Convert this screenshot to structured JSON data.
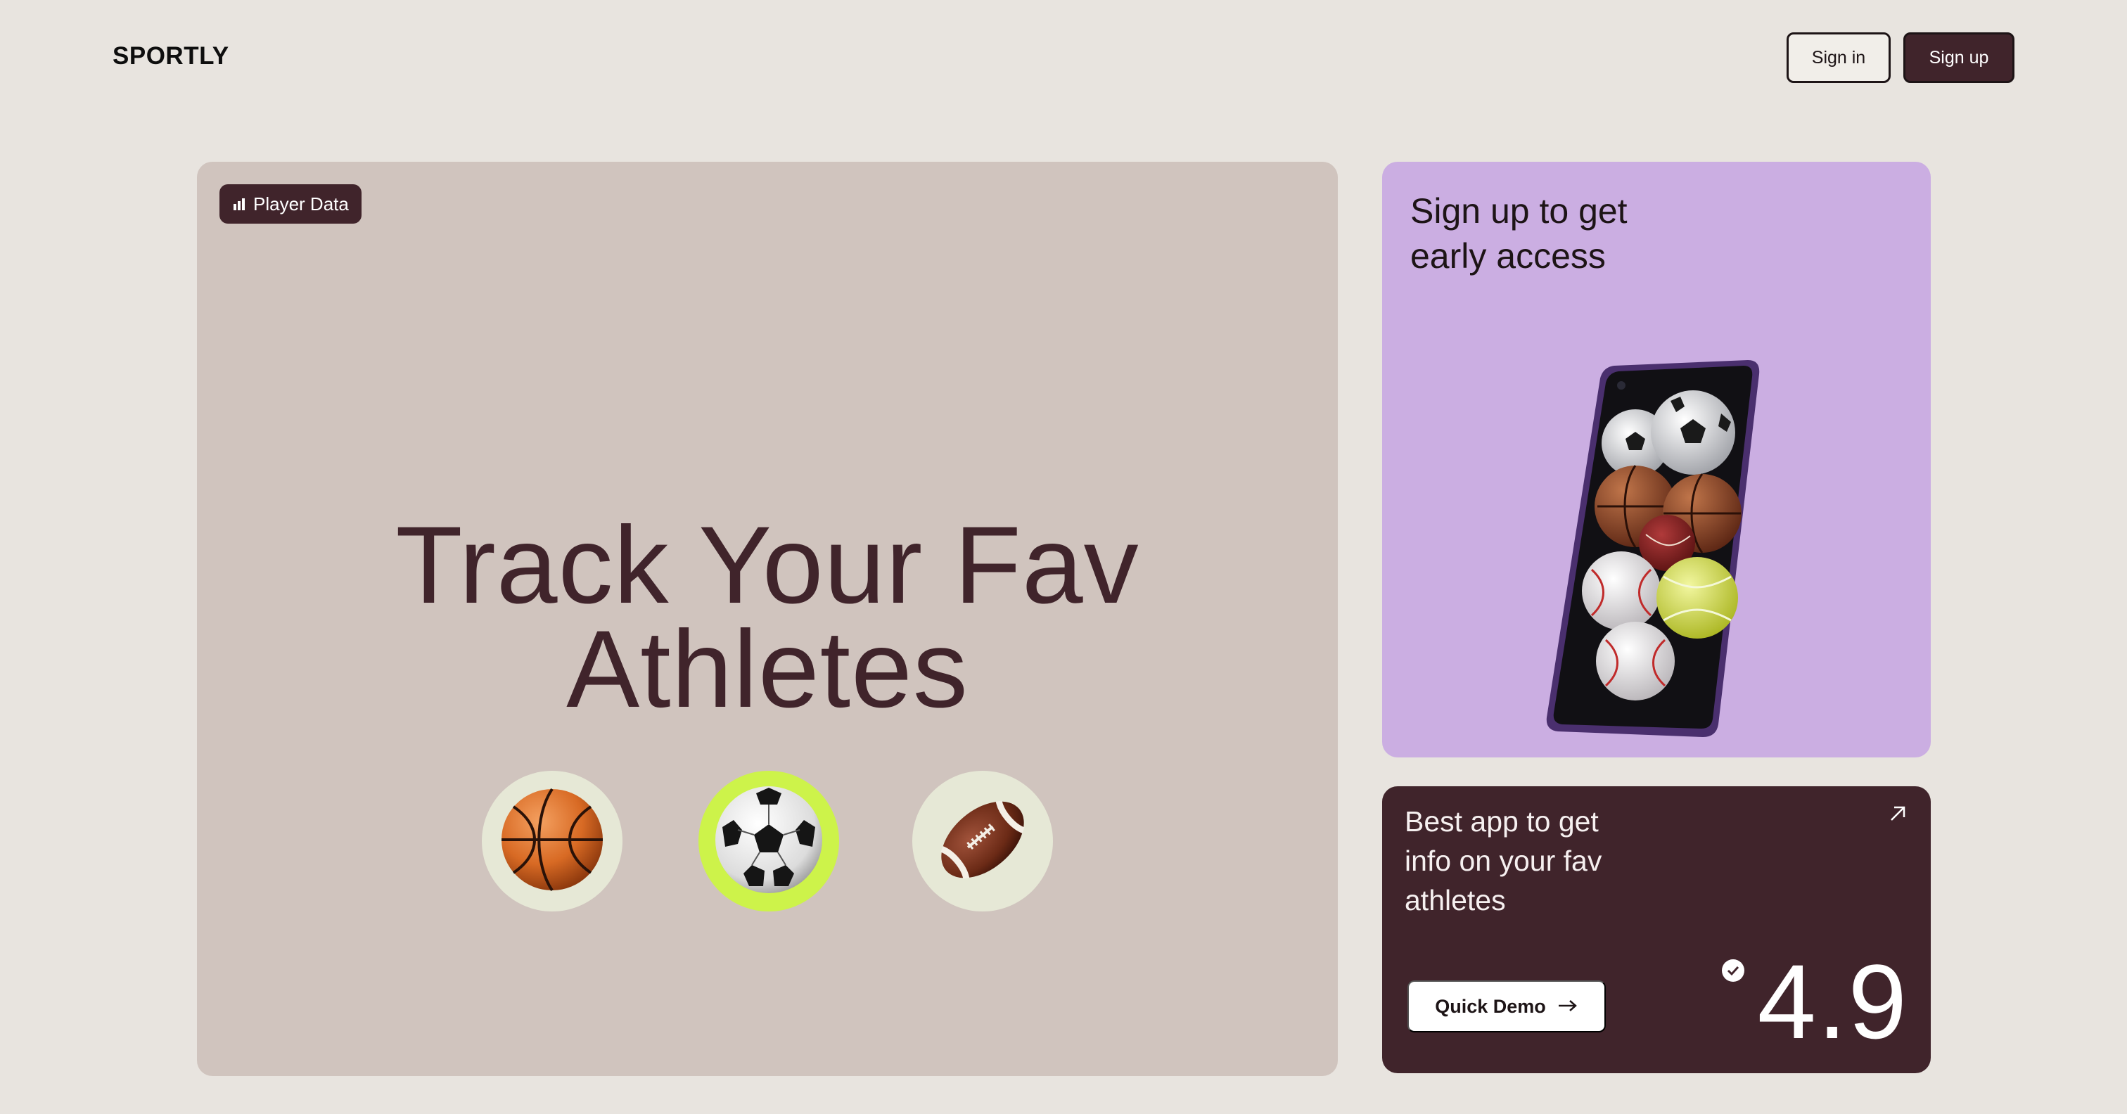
{
  "header": {
    "logo": "SPORTLY",
    "sign_in_label": "Sign in",
    "sign_up_label": "Sign up"
  },
  "hero": {
    "badge_icon": "bar-chart-icon",
    "badge_label": "Player Data",
    "title_line1": "Track Your Fav",
    "title_line2": "Athletes",
    "sports": [
      {
        "icon": "basketball-icon",
        "selected": false
      },
      {
        "icon": "soccer-ball-icon",
        "selected": true
      },
      {
        "icon": "football-icon",
        "selected": false
      }
    ]
  },
  "early_access": {
    "title": "Sign up to get early access",
    "image": "phone-with-sports-balls"
  },
  "rating_card": {
    "text": "Best app to get info on your fav athletes",
    "arrow_icon": "arrow-up-right-icon",
    "demo_label": "Quick Demo",
    "demo_icon": "arrow-right-icon",
    "check_icon": "check-badge-icon",
    "score": "4.9"
  },
  "colors": {
    "background": "#e8e4df",
    "brand_dark": "#40242b",
    "hero_card": "#d0c4be",
    "access_card": "#cbaee2",
    "highlight": "#cdf34a"
  }
}
